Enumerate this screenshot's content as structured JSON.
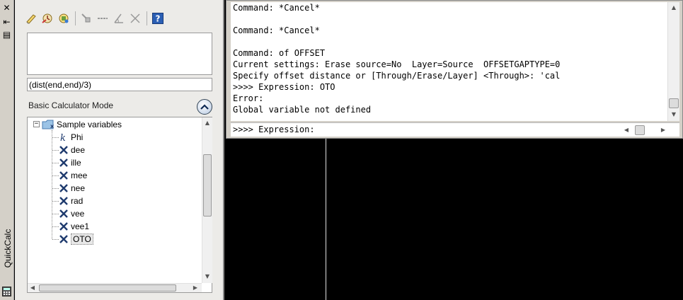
{
  "palette": {
    "title": "QuickCalc",
    "expression": "(dist(end,end)/3)",
    "mode_label": "Basic Calculator Mode",
    "tree": {
      "root_label": "Sample variables",
      "items": [
        {
          "label": "Phi",
          "icon": "constant-k-icon"
        },
        {
          "label": "dee",
          "icon": "function-x-icon"
        },
        {
          "label": "ille",
          "icon": "function-x-icon"
        },
        {
          "label": "mee",
          "icon": "function-x-icon"
        },
        {
          "label": "nee",
          "icon": "function-x-icon"
        },
        {
          "label": "rad",
          "icon": "function-x-icon"
        },
        {
          "label": "vee",
          "icon": "function-x-icon"
        },
        {
          "label": "vee1",
          "icon": "function-x-icon"
        },
        {
          "label": "OTO",
          "icon": "function-x-icon",
          "selected": true
        }
      ]
    },
    "colors": {
      "x_icon": "#1f3b6e",
      "accent": "#316ac5"
    }
  },
  "command_window": {
    "history": [
      "Command: *Cancel*",
      "",
      "Command: *Cancel*",
      "",
      "Command: of OFFSET",
      "Current settings: Erase source=No  Layer=Source  OFFSETGAPTYPE=0",
      "Specify offset distance or [Through/Erase/Layer] <Through>: 'cal",
      ">>>> Expression: OTO",
      "Error:",
      "Global variable not defined"
    ],
    "prompt": ">>>> Expression:"
  }
}
